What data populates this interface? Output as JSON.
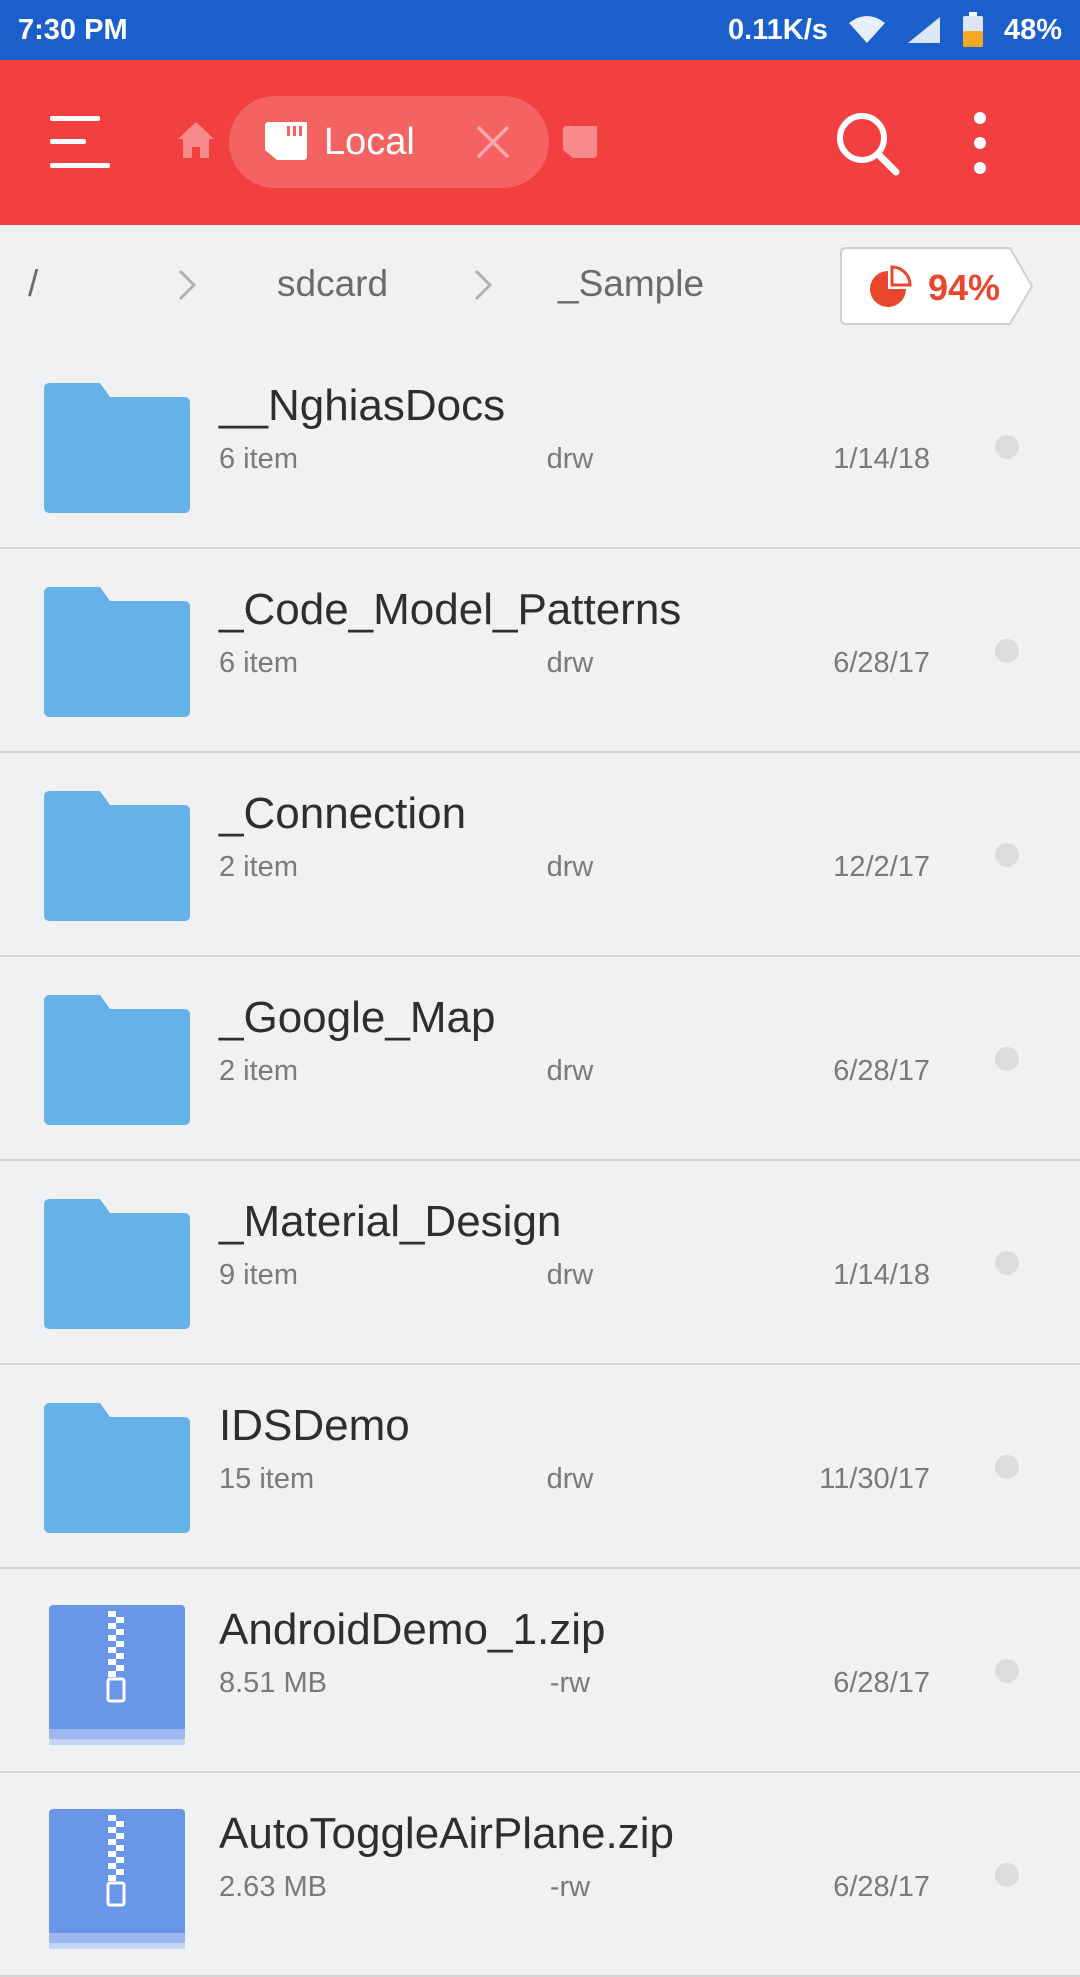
{
  "status_bar": {
    "time": "7:30 PM",
    "speed": "0.11K/s",
    "battery": "48%",
    "icons": [
      "wifi-icon",
      "signal-icon",
      "battery-icon"
    ]
  },
  "app_bar": {
    "tab_label": "Local",
    "icons": [
      "menu-icon",
      "home-icon",
      "sdcard-icon",
      "close-icon",
      "search-icon",
      "more-vert-icon"
    ],
    "colors": {
      "background": "#f23f3f",
      "chip": "#f56262"
    }
  },
  "breadcrumb": {
    "items": [
      "/",
      "sdcard",
      "_Sample"
    ],
    "storage_percent": "94%",
    "storage_used_fraction": 0.94
  },
  "files": [
    {
      "name": "__NghiasDocs",
      "meta": "6 item",
      "perm": "drw",
      "date": "1/14/18",
      "type": "folder"
    },
    {
      "name": "_Code_Model_Patterns",
      "meta": "6 item",
      "perm": "drw",
      "date": "6/28/17",
      "type": "folder"
    },
    {
      "name": "_Connection",
      "meta": "2 item",
      "perm": "drw",
      "date": "12/2/17",
      "type": "folder"
    },
    {
      "name": "_Google_Map",
      "meta": "2 item",
      "perm": "drw",
      "date": "6/28/17",
      "type": "folder"
    },
    {
      "name": "_Material_Design",
      "meta": "9 item",
      "perm": "drw",
      "date": "1/14/18",
      "type": "folder"
    },
    {
      "name": "IDSDemo",
      "meta": "15 item",
      "perm": "drw",
      "date": "11/30/17",
      "type": "folder"
    },
    {
      "name": "AndroidDemo_1.zip",
      "meta": "8.51 MB",
      "perm": "-rw",
      "date": "6/28/17",
      "type": "zip"
    },
    {
      "name": "AutoToggleAirPlane.zip",
      "meta": "2.63 MB",
      "perm": "-rw",
      "date": "6/28/17",
      "type": "zip"
    }
  ],
  "colors": {
    "status_bar": "#1a5fcb",
    "folder": "#66b1e8",
    "zip": "#6a96e8",
    "accent": "#e8472d"
  }
}
